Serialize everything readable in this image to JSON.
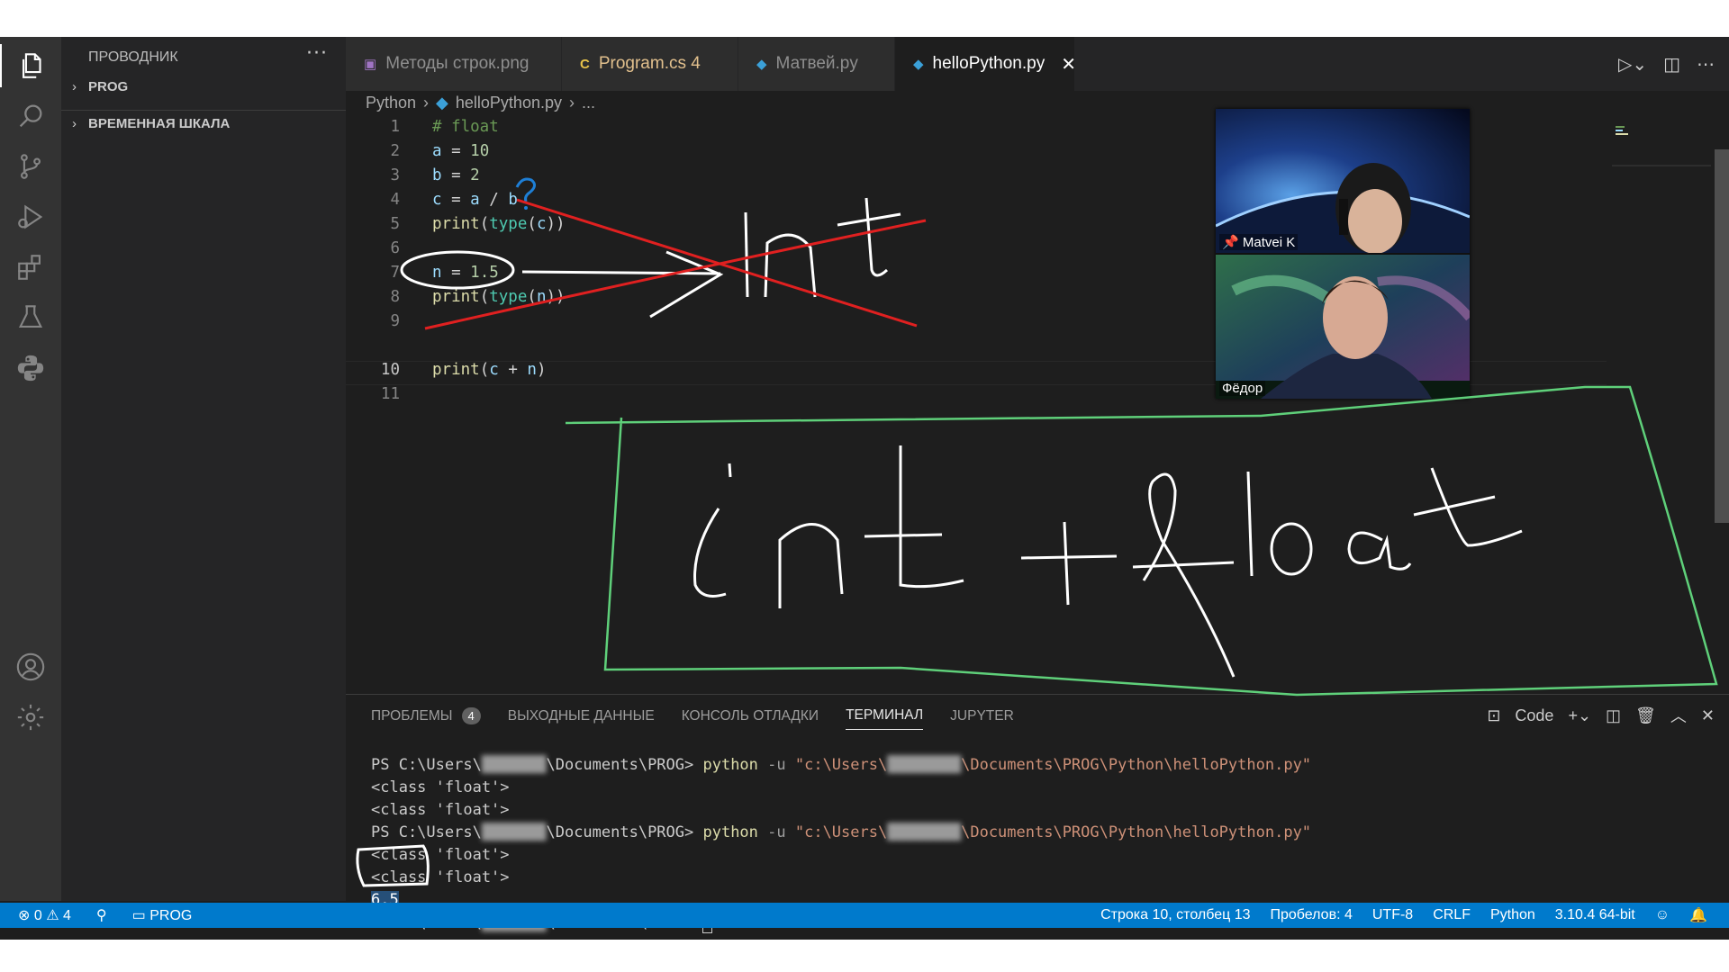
{
  "sidebar": {
    "title": "ПРОВОДНИК",
    "more": "···",
    "sections": [
      {
        "label": "PROG"
      },
      {
        "label": "ВРЕМЕННАЯ ШКАЛА"
      }
    ]
  },
  "tabs": [
    {
      "label": "Методы строк.png",
      "icon": "image-file-icon"
    },
    {
      "label": "Program.cs 4",
      "icon": "csharp-file-icon"
    },
    {
      "label": "Матвей.py",
      "icon": "python-file-icon"
    },
    {
      "label": "helloPython.py",
      "icon": "python-file-icon",
      "active": true
    }
  ],
  "breadcrumb": {
    "folder": "Python",
    "file": "helloPython.py",
    "more": "..."
  },
  "editor": {
    "current_line": "10",
    "lines": [
      {
        "n": "1"
      },
      {
        "n": "2"
      },
      {
        "n": "3"
      },
      {
        "n": "4"
      },
      {
        "n": "5"
      },
      {
        "n": "6"
      },
      {
        "n": "7"
      },
      {
        "n": "8"
      },
      {
        "n": "9"
      },
      {
        "n": "10"
      },
      {
        "n": "11"
      }
    ],
    "code": {
      "l1": "# float",
      "l2_var": "a",
      "l2_eq": " = ",
      "l2_val": "10",
      "l3_var": "b",
      "l3_eq": " = ",
      "l3_val": "2",
      "l4_var": "c",
      "l4_rest": " = ",
      "l4_a": "a",
      "l4_div": " / ",
      "l4_b": "b",
      "l5_fn": "print",
      "l5_p1": "(",
      "l5_bi": "type",
      "l5_p2": "(",
      "l5_arg": "c",
      "l5_p3": "))",
      "l7_var": "n",
      "l7_eq": " = ",
      "l7_val": "1.5",
      "l8_fn": "print",
      "l8_p1": "(",
      "l8_bi": "type",
      "l8_p2": "(",
      "l8_arg": "n",
      "l8_p3": "))",
      "l10_fn": "print",
      "l10_p1": "(",
      "l10_a": "c",
      "l10_op": " + ",
      "l10_b": "n",
      "l10_p2": ")"
    }
  },
  "panel": {
    "tabs": [
      {
        "label": "ПРОБЛЕМЫ",
        "badge": "4"
      },
      {
        "label": "ВЫХОДНЫЕ ДАННЫЕ"
      },
      {
        "label": "КОНСОЛЬ ОТЛАДКИ"
      },
      {
        "label": "ТЕРМИНАЛ",
        "active": true
      },
      {
        "label": "JUPYTER"
      }
    ],
    "actions": {
      "code_label": "Code"
    }
  },
  "terminal": {
    "prompt_prefix": "PS C:\\Users\\",
    "prompt_suffix": "\\Documents\\PROG> ",
    "cmd": "python",
    "flag": " -u ",
    "path_prefix": "\"c:\\Users\\",
    "path_suffix": "\\Documents\\PROG\\Python\\helloPython.py\"",
    "out1": "<class 'float'>",
    "out2": "<class 'float'>",
    "out3": "<class 'float'>",
    "out4": "<class 'float'>",
    "result": "6.5"
  },
  "status": {
    "errors": "0",
    "warnings": "4",
    "folder": "PROG",
    "position": "Строка 10, столбец 13",
    "spaces": "Пробелов: 4",
    "encoding": "UTF-8",
    "eol": "CRLF",
    "language": "Python",
    "interpreter": "3.10.4 64-bit"
  },
  "video": {
    "participants": [
      {
        "name": "Matvei K"
      },
      {
        "name": "Фёдор"
      }
    ]
  },
  "colors": {
    "accent": "#007acc",
    "ink_red": "#e02020",
    "ink_green": "#5fd07a",
    "ink_white": "#ffffff"
  }
}
